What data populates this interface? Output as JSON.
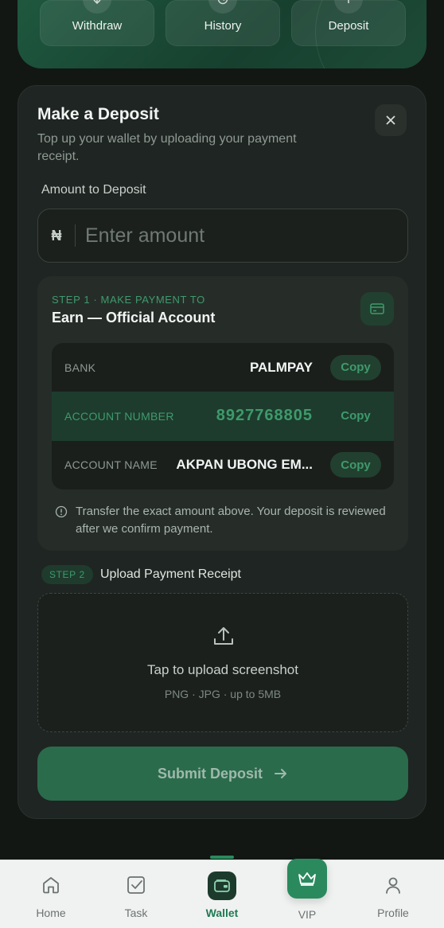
{
  "quick_actions": [
    {
      "label": "Withdraw",
      "icon": "withdraw-icon"
    },
    {
      "label": "History",
      "icon": "history-icon"
    },
    {
      "label": "Deposit",
      "icon": "deposit-icon"
    }
  ],
  "deposit": {
    "title": "Make a Deposit",
    "subtitle": "Top up your wallet by uploading your payment receipt.",
    "amount_label": "Amount to Deposit",
    "currency_symbol": "₦",
    "amount_placeholder": "Enter amount",
    "amount_value": ""
  },
  "step1": {
    "kicker": "STEP 1 · MAKE PAYMENT TO",
    "title": "Earn — Official Account",
    "rows": [
      {
        "label": "BANK",
        "value": "PALMPAY",
        "copy": "Copy"
      },
      {
        "label": "ACCOUNT NUMBER",
        "value": "8927768805",
        "copy": "Copy"
      },
      {
        "label": "ACCOUNT NAME",
        "value": "AKPAN UBONG EM...",
        "copy": "Copy"
      }
    ],
    "note": "Transfer the exact amount above. Your deposit is reviewed after we confirm payment."
  },
  "step2": {
    "badge": "STEP 2",
    "title": "Upload Payment Receipt",
    "upload_title": "Tap to upload screenshot",
    "upload_hint": "PNG · JPG · up to 5MB"
  },
  "submit_label": "Submit Deposit",
  "nav": [
    {
      "label": "Home",
      "icon": "home-icon"
    },
    {
      "label": "Task",
      "icon": "task-icon"
    },
    {
      "label": "Wallet",
      "icon": "wallet-icon",
      "active": true
    },
    {
      "label": "VIP",
      "icon": "crown-icon"
    },
    {
      "label": "Profile",
      "icon": "profile-icon"
    }
  ],
  "colors": {
    "accent": "#3e9a6c",
    "background": "#121714",
    "panel": "#1f2522",
    "submit": "#2a6b4c"
  }
}
